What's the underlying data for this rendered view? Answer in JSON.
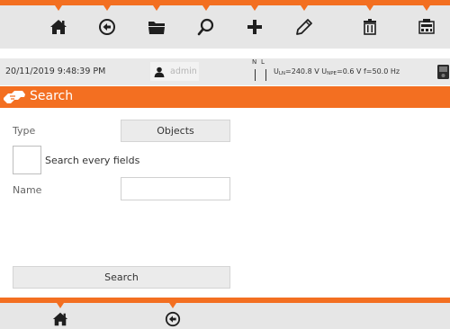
{
  "toolbar": {
    "buttons": [
      {
        "icon": "home-icon"
      },
      {
        "icon": "back-circle-icon"
      },
      {
        "icon": "folder-icon"
      },
      {
        "icon": "search-icon"
      },
      {
        "icon": "plus-icon"
      },
      {
        "icon": "pencil-icon"
      },
      {
        "icon": "trash-icon"
      },
      {
        "icon": "meter-icon"
      }
    ]
  },
  "status": {
    "datetime": "20/11/2019 9:48:39 PM",
    "user": "admin",
    "n_label": "N",
    "l_label": "L",
    "u_ln_prefix": "U",
    "u_ln_sub": "LN",
    "u_ln_value": "=240.8 V",
    "u_npe_prefix": "U",
    "u_npe_sub": "NPE",
    "u_npe_value": "=0.6 V",
    "freq": "f=50.0 Hz"
  },
  "title": {
    "text": "Search",
    "icon": "search-hand-icon"
  },
  "form": {
    "type_label": "Type",
    "type_value": "Objects",
    "search_every_label": "Search every fields",
    "search_every_checked": false,
    "name_label": "Name",
    "name_value": "",
    "search_button": "Search"
  },
  "bottom": {
    "buttons": [
      {
        "icon": "home-icon"
      },
      {
        "icon": "back-circle-icon"
      }
    ]
  },
  "colors": {
    "accent": "#f36f21",
    "bar_bg": "#e6e6e6"
  }
}
